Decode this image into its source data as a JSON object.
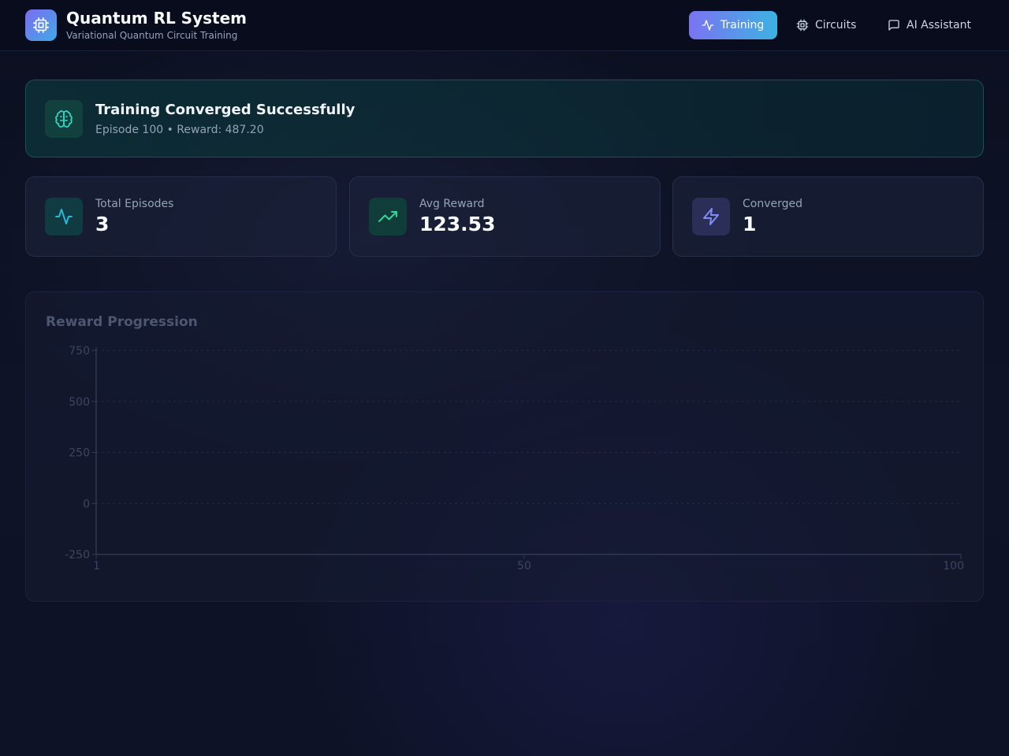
{
  "header": {
    "title": "Quantum RL System",
    "subtitle": "Variational Quantum Circuit Training",
    "logo_icon": "cpu-icon"
  },
  "nav": {
    "training_label": "Training",
    "circuits_label": "Circuits",
    "assistant_label": "AI Assistant"
  },
  "banner": {
    "title": "Training Converged Successfully",
    "subtitle": "Episode 100 • Reward: 487.20",
    "icon": "brain-icon"
  },
  "stats": [
    {
      "label": "Total Episodes",
      "value": "3",
      "icon": "activity-icon",
      "accent": "#2dd4bf"
    },
    {
      "label": "Avg Reward",
      "value": "123.53",
      "icon": "trending-up-icon",
      "accent": "#34d399"
    },
    {
      "label": "Converged",
      "value": "1",
      "icon": "zap-icon",
      "accent": "#818cf8"
    }
  ],
  "colors": {
    "accent_start": "#7b73f2",
    "accent_end": "#3db2e2",
    "success": "#2dd4bf"
  },
  "chart_data": {
    "type": "line",
    "title": "Reward Progression",
    "x_ticks": [
      "1",
      "50",
      "100"
    ],
    "y_ticks": [
      "750",
      "500",
      "250",
      "0",
      "-250"
    ],
    "xlim": [
      1,
      100
    ],
    "ylim": [
      -250,
      750
    ],
    "grid": true,
    "series": []
  }
}
